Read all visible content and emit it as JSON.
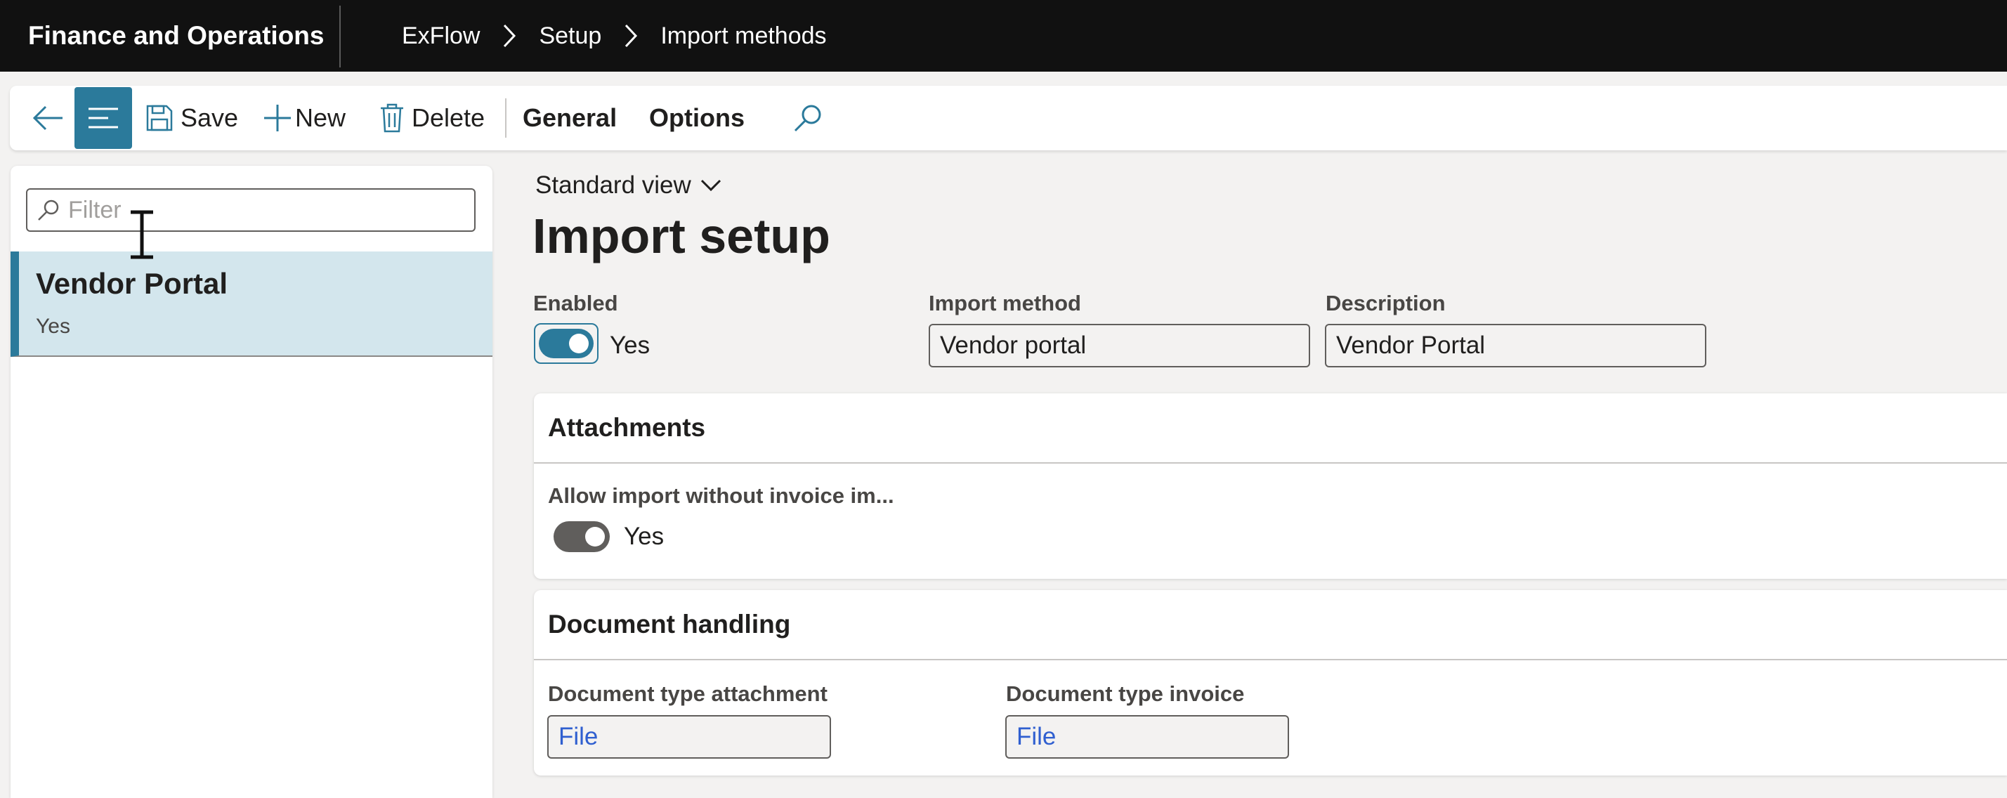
{
  "header": {
    "app_title": "Finance and Operations",
    "breadcrumb": [
      "ExFlow",
      "Setup",
      "Import methods"
    ]
  },
  "actionbar": {
    "save_label": "Save",
    "new_label": "New",
    "delete_label": "Delete",
    "tabs": [
      "General",
      "Options"
    ]
  },
  "list": {
    "filter_placeholder": "Filter",
    "items": [
      {
        "title": "Vendor Portal",
        "subtitle": "Yes"
      }
    ]
  },
  "form": {
    "view_label": "Standard view",
    "title": "Import setup",
    "enabled": {
      "label": "Enabled",
      "value_text": "Yes",
      "on": true
    },
    "import_method": {
      "label": "Import method",
      "value": "Vendor portal"
    },
    "description": {
      "label": "Description",
      "value": "Vendor Portal"
    }
  },
  "attachments": {
    "header": "Attachments",
    "allow_import": {
      "label": "Allow import without invoice im...",
      "value_text": "Yes",
      "on": true
    }
  },
  "document_handling": {
    "header": "Document handling",
    "attachment_type": {
      "label": "Document type attachment",
      "value": "File"
    },
    "invoice_type": {
      "label": "Document type invoice",
      "value": "File"
    }
  },
  "colors": {
    "accent": "#2b7a9b",
    "topbar": "#111111",
    "selected_row": "#d3e6ed",
    "link": "#2f5fd0",
    "toggle_off_dark": "#605e5c"
  },
  "icons": {
    "back": "arrow-left-icon",
    "nav": "list-lines-icon",
    "save": "floppy-disk-icon",
    "new": "plus-icon",
    "delete": "trash-icon",
    "search": "magnifier-icon",
    "view_dropdown": "chevron-down-icon",
    "breadcrumb_sep": "chevron-right-icon"
  }
}
